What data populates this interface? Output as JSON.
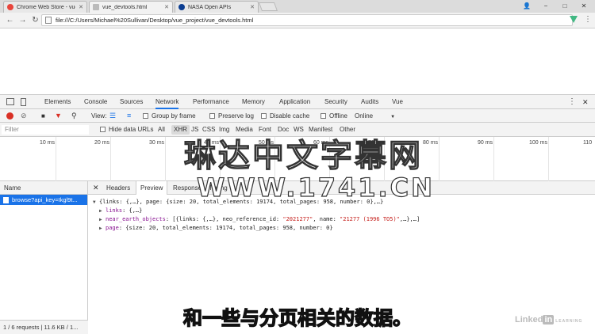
{
  "browser": {
    "tabs": [
      {
        "label": "Chrome Web Store - vue",
        "icon_color": "#e8453c"
      },
      {
        "label": "vue_devtools.html",
        "icon_color": "#bbbbbb"
      },
      {
        "label": "NASA Open APIs",
        "icon_color": "#0b3d91"
      }
    ],
    "url": "file:///C:/Users/Michael%20Sullivan/Desktop/vue_project/vue_devtools.html",
    "window_controls": [
      "−",
      "□",
      "✕"
    ],
    "back": "←",
    "forward": "→",
    "reload": "↻",
    "menu": "⋮"
  },
  "devtools": {
    "tabs": [
      "Elements",
      "Console",
      "Sources",
      "Network",
      "Performance",
      "Memory",
      "Application",
      "Security",
      "Audits",
      "Vue"
    ],
    "active_tab": "Network",
    "toolbar": {
      "view_label": "View:",
      "group_by_frame": "Group by frame",
      "preserve_log": "Preserve log",
      "disable_cache": "Disable cache",
      "offline": "Offline",
      "throttle": "Online"
    },
    "filter": {
      "placeholder": "Filter",
      "hide_data_urls": "Hide data URLs",
      "types": [
        "All",
        "XHR",
        "JS",
        "CSS",
        "Img",
        "Media",
        "Font",
        "Doc",
        "WS",
        "Manifest",
        "Other"
      ],
      "selected": "XHR"
    },
    "timeline_ticks": [
      "10 ms",
      "20 ms",
      "30 ms",
      "40 ms",
      "50 ms",
      "60 ms",
      "70 ms",
      "80 ms",
      "90 ms",
      "100 ms",
      "110"
    ],
    "requests": {
      "header": "Name",
      "items": [
        "browse?api_key=Ikgl9t..."
      ]
    },
    "status_text": "1 / 6 requests | 11.6 KB / 1...",
    "detail_tabs": [
      "Headers",
      "Preview",
      "Response",
      "Timing"
    ],
    "active_detail_tab": "Preview",
    "preview": {
      "root": "{links: {,…}, page: {size: 20, total_elements: 19174, total_pages: 958, number: 0},…}",
      "links_key": "links",
      "links_val": ": {,…}",
      "neo_key": "near_earth_objects",
      "neo_val_a": ": [{links: {,…}, neo_reference_id: ",
      "neo_id": "\"2021277\"",
      "neo_val_b": ", name: ",
      "neo_name": "\"21277 (1996 TO5)\"",
      "neo_val_c": ",…},…]",
      "page_key": "page",
      "page_val": ": {size: 20, total_elements: 19174, total_pages: 958, number: 0}"
    }
  },
  "overlays": {
    "watermark_1": "琳达中文字幕网",
    "watermark_2": "WWW.1741.CN",
    "subtitle": "和一些与分页相关的数据。",
    "brand": "Linked",
    "brand_in": "in",
    "brand_learning": "LEARNING"
  }
}
